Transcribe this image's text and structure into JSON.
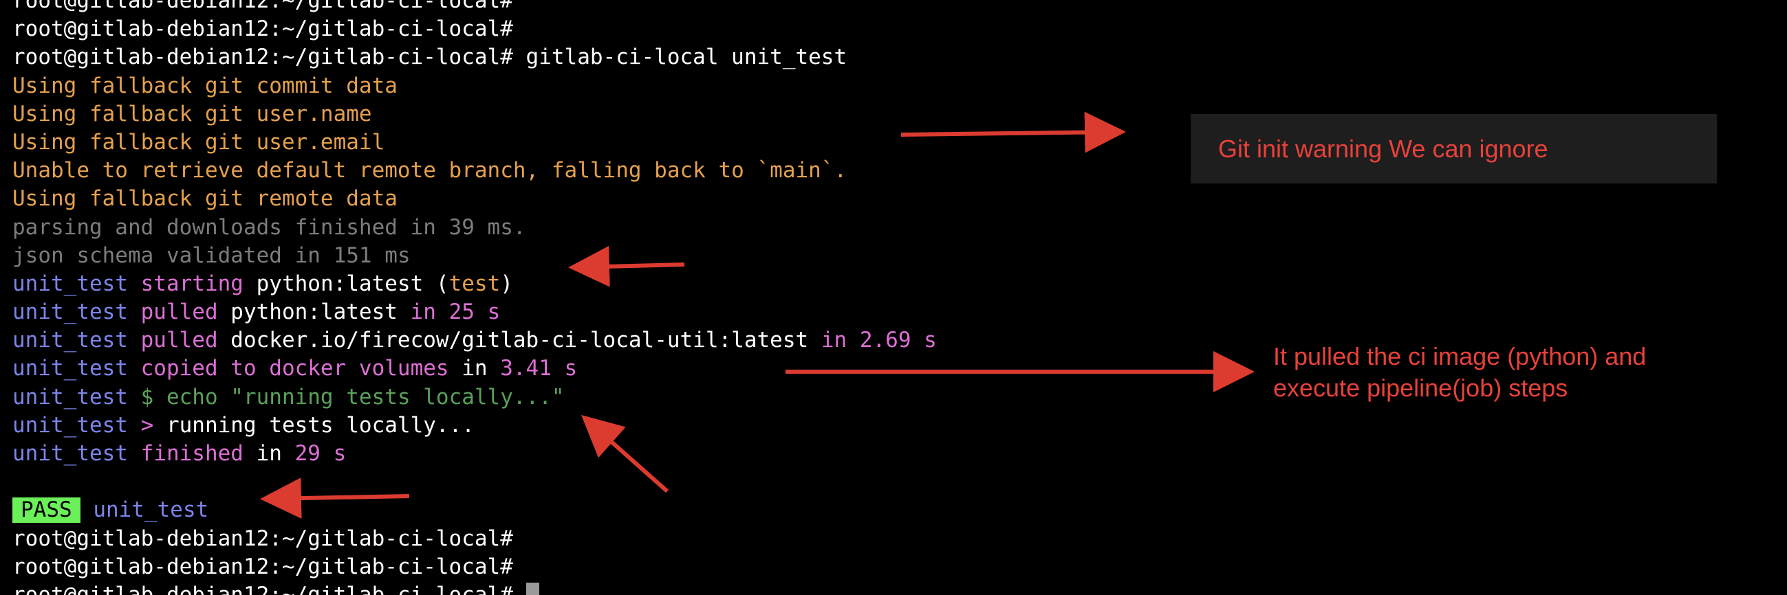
{
  "terminal": {
    "lines": [
      {
        "segments": [
          {
            "text": "root@gitlab-debian12:~/gitlab-ci-local#",
            "color": "white"
          }
        ]
      },
      {
        "segments": [
          {
            "text": "root@gitlab-debian12:~/gitlab-ci-local#",
            "color": "white"
          }
        ]
      },
      {
        "segments": [
          {
            "text": "root@gitlab-debian12:~/gitlab-ci-local# gitlab-ci-local unit_test",
            "color": "white"
          }
        ]
      },
      {
        "segments": [
          {
            "text": "Using fallback git commit data",
            "color": "orange"
          }
        ]
      },
      {
        "segments": [
          {
            "text": "Using fallback git user.name",
            "color": "orange"
          }
        ]
      },
      {
        "segments": [
          {
            "text": "Using fallback git user.email",
            "color": "orange"
          }
        ]
      },
      {
        "segments": [
          {
            "text": "Unable to retrieve default remote branch, falling back to `main`.",
            "color": "orange"
          }
        ]
      },
      {
        "segments": [
          {
            "text": "Using fallback git remote data",
            "color": "orange"
          }
        ]
      },
      {
        "segments": [
          {
            "text": "parsing and downloads finished in 39 ms.",
            "color": "gray"
          }
        ]
      },
      {
        "segments": [
          {
            "text": "json schema validated in 151 ms",
            "color": "gray"
          }
        ]
      },
      {
        "segments": [
          {
            "text": "unit_test ",
            "color": "blue"
          },
          {
            "text": "starting ",
            "color": "magenta"
          },
          {
            "text": "python:latest (",
            "color": "white"
          },
          {
            "text": "test",
            "color": "orange"
          },
          {
            "text": ")",
            "color": "white"
          }
        ]
      },
      {
        "segments": [
          {
            "text": "unit_test ",
            "color": "blue"
          },
          {
            "text": "pulled ",
            "color": "magenta"
          },
          {
            "text": "python:latest ",
            "color": "white"
          },
          {
            "text": "in ",
            "color": "magenta"
          },
          {
            "text": "25 s",
            "color": "magenta"
          }
        ]
      },
      {
        "segments": [
          {
            "text": "unit_test ",
            "color": "blue"
          },
          {
            "text": "pulled ",
            "color": "magenta"
          },
          {
            "text": "docker.io/firecow/gitlab-ci-local-util:latest ",
            "color": "white"
          },
          {
            "text": "in ",
            "color": "magenta"
          },
          {
            "text": "2.69 s",
            "color": "magenta"
          }
        ]
      },
      {
        "segments": [
          {
            "text": "unit_test ",
            "color": "blue"
          },
          {
            "text": "copied to docker volumes ",
            "color": "magenta"
          },
          {
            "text": "in ",
            "color": "white"
          },
          {
            "text": "3.41 s",
            "color": "magenta"
          }
        ]
      },
      {
        "segments": [
          {
            "text": "unit_test ",
            "color": "blue"
          },
          {
            "text": "$ echo \"running tests locally...\"",
            "color": "green"
          }
        ]
      },
      {
        "segments": [
          {
            "text": "unit_test ",
            "color": "blue"
          },
          {
            "text": "> ",
            "color": "magenta"
          },
          {
            "text": "running tests locally...",
            "color": "white"
          }
        ]
      },
      {
        "segments": [
          {
            "text": "unit_test ",
            "color": "blue"
          },
          {
            "text": "finished ",
            "color": "magenta"
          },
          {
            "text": "in ",
            "color": "white"
          },
          {
            "text": "29 s",
            "color": "magenta"
          }
        ]
      },
      {
        "segments": []
      },
      {
        "segments": [
          {
            "text": "PASS",
            "color": "badge"
          },
          {
            "text": " unit_test",
            "color": "blue"
          }
        ]
      },
      {
        "segments": [
          {
            "text": "root@gitlab-debian12:~/gitlab-ci-local#",
            "color": "white"
          }
        ]
      },
      {
        "segments": [
          {
            "text": "root@gitlab-debian12:~/gitlab-ci-local#",
            "color": "white"
          }
        ]
      },
      {
        "segments": [
          {
            "text": "root@gitlab-debian12:~/gitlab-ci-local# ",
            "color": "white"
          }
        ],
        "cursor": true
      }
    ]
  },
  "annotations": {
    "warning_note": "Git init warning We can ignore",
    "pull_note_line1": "It pulled the ci image (python) and",
    "pull_note_line2": "execute pipeline(job) steps"
  },
  "colors": {
    "background": "#000000",
    "white": "#ffffff",
    "orange": "#e5a04e",
    "gray": "#7c7c7c",
    "blue": "#7b84e8",
    "magenta": "#dd6fd6",
    "green": "#5aa05a",
    "badge": "#6cf05a",
    "annotation_red": "#e8413a",
    "warning_box": "#1e1e1e"
  },
  "icons": {
    "cursor": "block-cursor-icon",
    "arrow": "red-arrow-icon"
  }
}
